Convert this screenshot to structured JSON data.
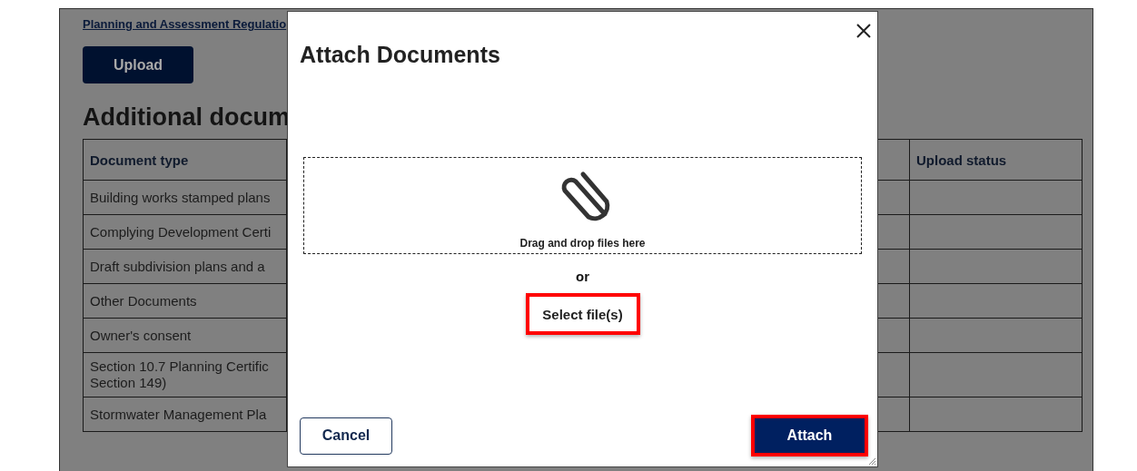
{
  "page": {
    "link": "Planning and Assessment Regulatio",
    "upload_button": "Upload",
    "heading": "Additional docum",
    "table": {
      "columns": [
        "Document type",
        "Upload status"
      ],
      "rows": [
        {
          "lines": [
            "Building works stamped plans"
          ]
        },
        {
          "lines": [
            "Complying Development Certi"
          ]
        },
        {
          "lines": [
            "Draft subdivision plans and a"
          ]
        },
        {
          "lines": [
            "Other Documents"
          ]
        },
        {
          "lines": [
            "Owner's consent"
          ]
        },
        {
          "lines": [
            "Section 10.7 Planning Certific",
            "Section 149)"
          ]
        },
        {
          "lines": [
            "Stormwater Management Pla"
          ]
        }
      ]
    }
  },
  "dialog": {
    "title": "Attach Documents",
    "dropzone_text": "Drag and drop files here",
    "separator": "or",
    "buttons": [
      {
        "kind": "select",
        "label": "Select file(s)",
        "highlighted": true
      },
      {
        "kind": "cancel",
        "label": "Cancel",
        "highlighted": false
      },
      {
        "kind": "attach",
        "label": "Attach",
        "highlighted": true
      }
    ]
  }
}
